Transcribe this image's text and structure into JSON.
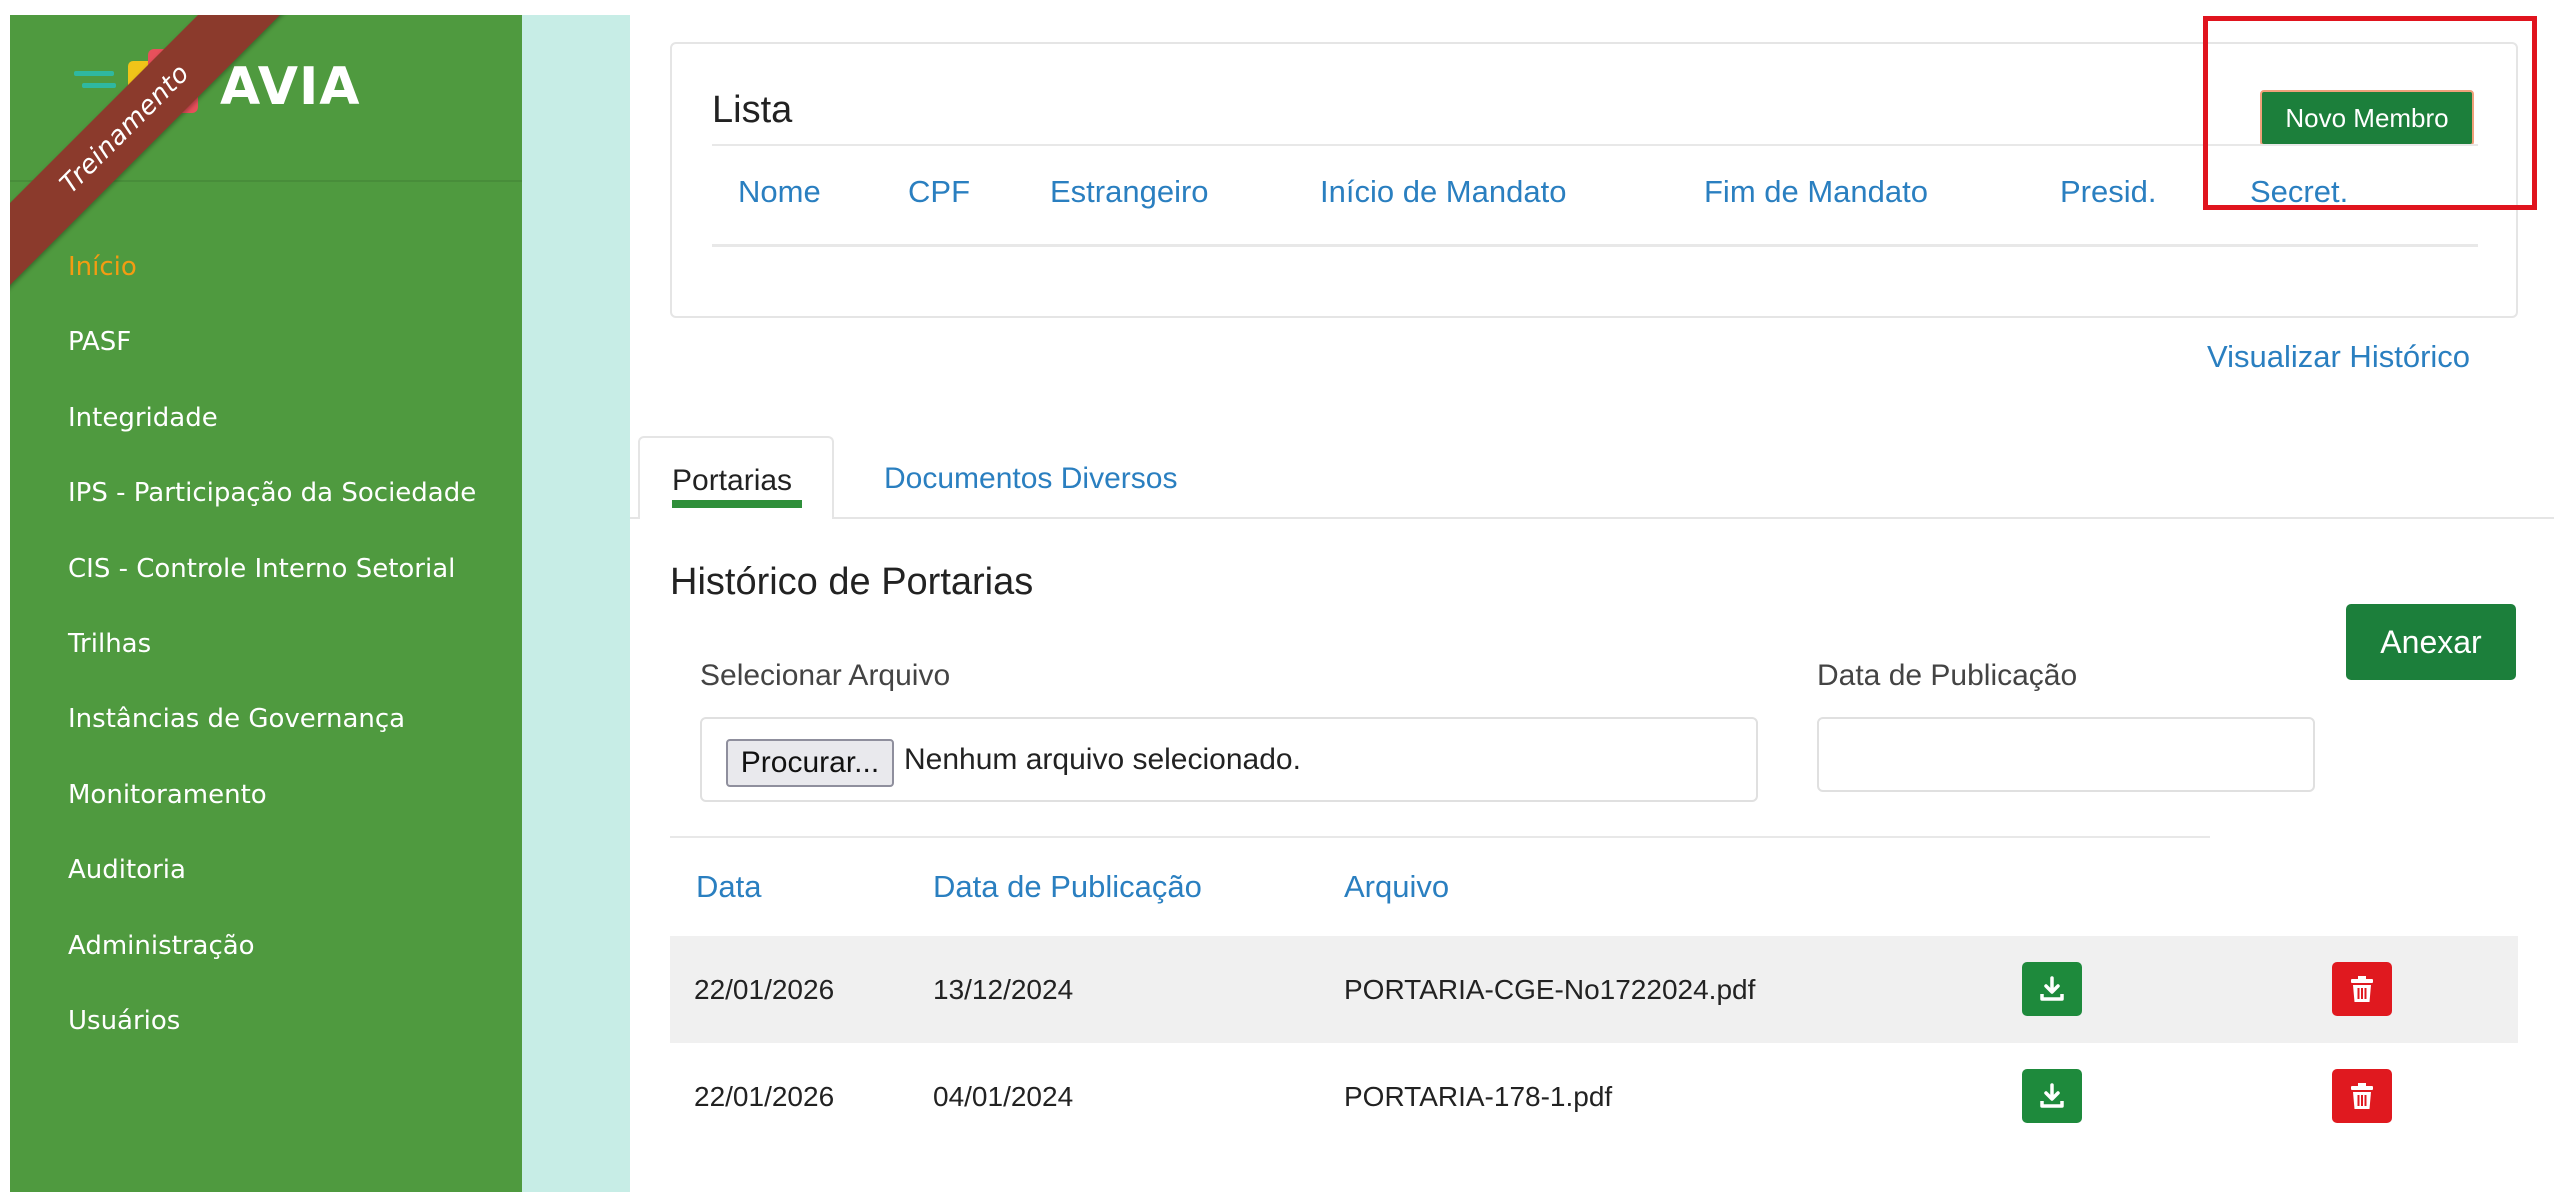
{
  "brand": {
    "name": "AVIA",
    "ribbon": "Treinamento",
    "colors": {
      "sidebar": "#4f9a3f",
      "active": "#f39c12",
      "primary_button": "#1c7f3b",
      "link": "#2a7fc0",
      "danger": "#e0191f"
    }
  },
  "sidebar": {
    "items": [
      {
        "label": "Início",
        "active": true
      },
      {
        "label": "PASF"
      },
      {
        "label": "Integridade"
      },
      {
        "label": "IPS - Participação da Sociedade"
      },
      {
        "label": "CIS - Controle Interno Setorial"
      },
      {
        "label": "Trilhas"
      },
      {
        "label": "Instâncias de Governança"
      },
      {
        "label": "Monitoramento"
      },
      {
        "label": "Auditoria"
      },
      {
        "label": "Administração"
      },
      {
        "label": "Usuários"
      }
    ]
  },
  "lista": {
    "title": "Lista",
    "new_member_label": "Novo Membro",
    "columns": [
      "Nome",
      "CPF",
      "Estrangeiro",
      "Início de Mandato",
      "Fim de Mandato",
      "Presid.",
      "Secret."
    ],
    "history_link": "Visualizar Histórico"
  },
  "tabs": [
    {
      "label": "Portarias",
      "active": true
    },
    {
      "label": "Documentos Diversos"
    }
  ],
  "portarias": {
    "title": "Histórico de Portarias",
    "attach_label": "Anexar",
    "file_label": "Selecionar Arquivo",
    "browse_label": "Procurar...",
    "file_status": "Nenhum arquivo selecionado.",
    "pub_date_label": "Data de Publicação",
    "pub_date_value": "",
    "columns": [
      "Data",
      "Data de Publicação",
      "Arquivo"
    ],
    "rows": [
      {
        "date": "22/01/2026",
        "pub_date": "13/12/2024",
        "file": "PORTARIA-CGE-No1722024.pdf"
      },
      {
        "date": "22/01/2026",
        "pub_date": "04/01/2024",
        "file": "PORTARIA-178-1.pdf"
      }
    ],
    "row_icons": {
      "download": "download-icon",
      "delete": "trash-icon"
    }
  }
}
